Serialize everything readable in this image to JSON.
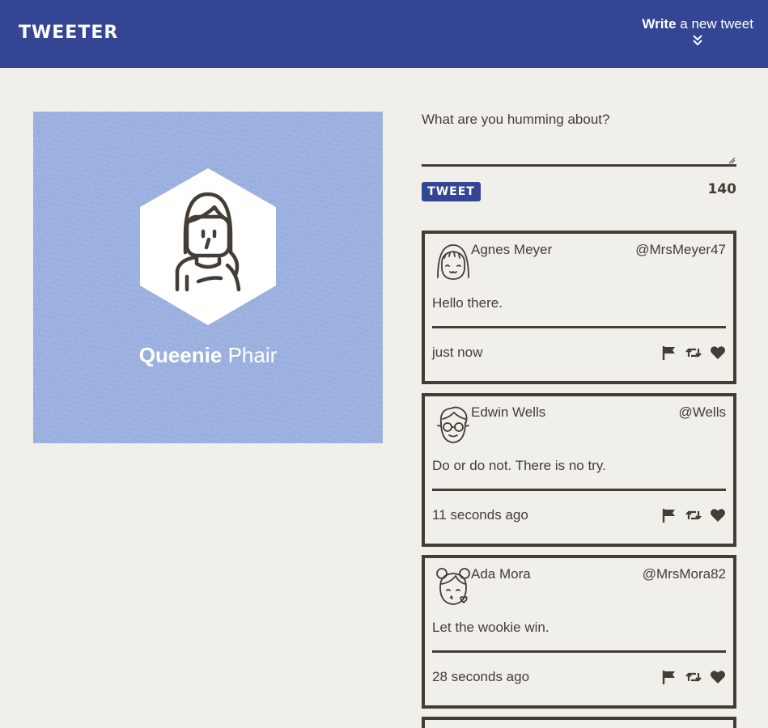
{
  "nav": {
    "brand": "Tweeter",
    "compose_bold": "Write",
    "compose_rest": " a new tweet",
    "compose_icon": "double-chevron-down-icon"
  },
  "colors": {
    "nav_bg": "#334593",
    "page_bg": "#f1efea",
    "profile_bg": "#9db2e0",
    "text": "#433d36",
    "button_bg": "#334593"
  },
  "profile": {
    "first_name": "Queenie",
    "last_name": "Phair",
    "avatar_icon": "woman-long-hair-avatar-icon"
  },
  "composer": {
    "placeholder": "What are you humming about?",
    "value": "",
    "submit_label": "Tweet",
    "char_counter": "140"
  },
  "tweets": [
    {
      "name": "Agnes Meyer",
      "handle": "@MrsMeyer47",
      "text": "Hello there.",
      "time": "just now",
      "avatar_icon": "smiling-girl-bangs-avatar-icon"
    },
    {
      "name": "Edwin Wells",
      "handle": "@Wells",
      "text": "Do or do not. There is no try.",
      "time": "11 seconds ago",
      "avatar_icon": "man-glasses-avatar-icon"
    },
    {
      "name": "Ada Mora",
      "handle": "@MrsMora82",
      "text": "Let the wookie win.",
      "time": "28 seconds ago",
      "avatar_icon": "girl-buns-kiss-avatar-icon"
    }
  ],
  "action_icons": [
    "flag-icon",
    "retweet-icon",
    "heart-icon"
  ]
}
